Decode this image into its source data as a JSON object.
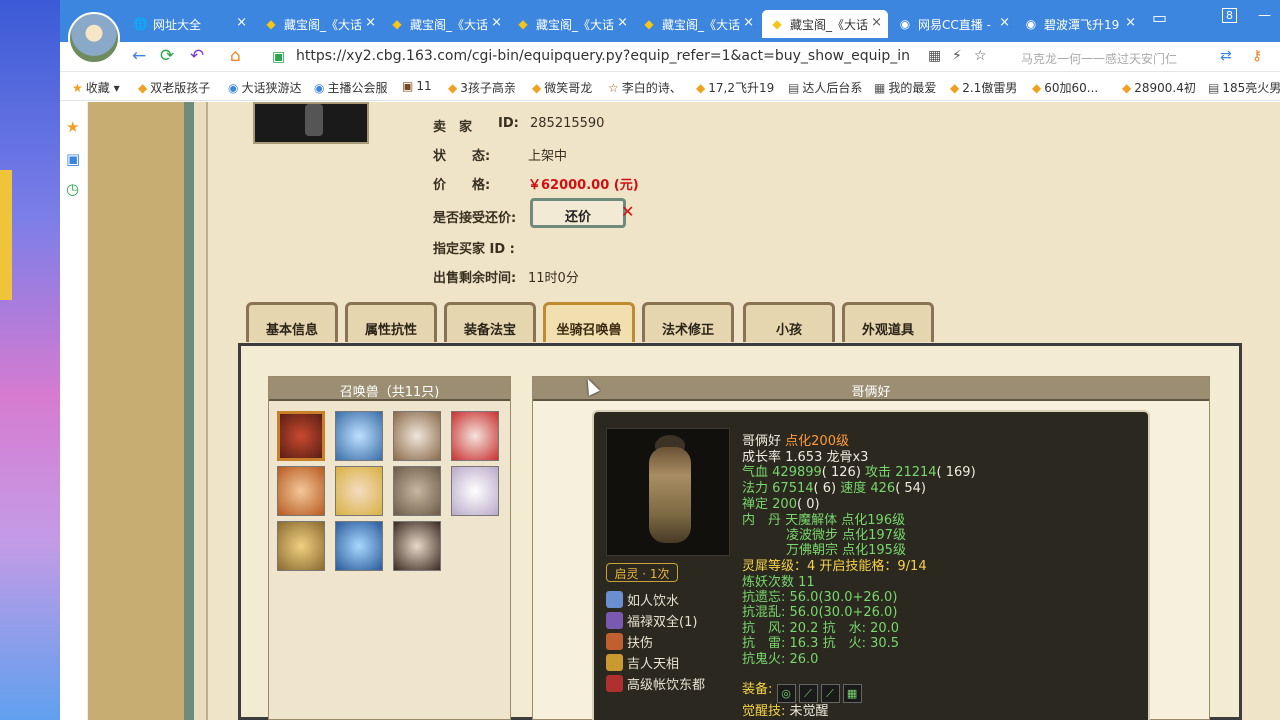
{
  "browser": {
    "tabs": [
      {
        "title": "网址大全",
        "icon": "globe-icon"
      },
      {
        "title": "藏宝阁_《大话",
        "icon": "treasure-icon"
      },
      {
        "title": "藏宝阁_《大话",
        "icon": "treasure-icon"
      },
      {
        "title": "藏宝阁_《大话",
        "icon": "treasure-icon"
      },
      {
        "title": "藏宝阁_《大话",
        "icon": "treasure-icon"
      },
      {
        "title": "藏宝阁_《大话",
        "icon": "treasure-icon"
      },
      {
        "title": "网易CC直播 -",
        "icon": "cc-icon"
      },
      {
        "title": "碧波潭飞升19",
        "icon": "cc-icon"
      }
    ],
    "tab_count_badge": "8",
    "url": "https://xy2.cbg.163.com/cgi-bin/equipquery.py?equip_refer=1&act=buy_show_equip_info&equi",
    "search_placeholder": "马克龙一何一一感过天安门仁"
  },
  "bookmarks": [
    "收藏",
    "双老版孩子",
    "大话狭游达",
    "主播公会服",
    "11",
    "3孩子高亲",
    "微笑哥龙",
    "李白的诗、",
    "17,2飞升19",
    "达人后台系",
    "我的最爱",
    "2.1傲雷男",
    "60加60...",
    "28900.4初",
    "185亮火男"
  ],
  "seller": {
    "id_label": "卖　家",
    "id_key": "ID:",
    "id": "285215590",
    "status_label": "状　　态:",
    "status": "上架中",
    "price_label": "价　　格:",
    "price": "￥62000.00 (元)",
    "counter_label": "是否接受还价:",
    "counter_button": "还价",
    "buyer_label": "指定买家 ID :",
    "remaining_label": "出售剩余时间:",
    "remaining": "11时0分"
  },
  "tabs": [
    "基本信息",
    "属性抗性",
    "装备法宝",
    "坐骑召唤兽",
    "法术修正",
    "小孩",
    "外观道具"
  ],
  "pets": {
    "header": "召唤兽（共11只)",
    "count": 11
  },
  "detail": {
    "header": "哥俩好",
    "name": "哥俩好",
    "name_suffix": "点化200级",
    "growth": "成长率 1.653 龙骨x3",
    "hp_label": "气血",
    "hp": "429899",
    "hp_extra": "( 126)",
    "atk_label": "攻击",
    "atk": "21214",
    "atk_extra": "( 169)",
    "mp_label": "法力",
    "mp": "67514",
    "mp_extra": "( 6)",
    "spd_label": "速度",
    "spd": "426",
    "spd_extra": "( 54)",
    "zen_label": "禅定",
    "zen": "200",
    "zen_extra": "( 0)",
    "neidan_label": "内　丹",
    "neidan": [
      "天魔解体 点化196级",
      "凌波微步 点化197级",
      "万佛朝宗 点化195级"
    ],
    "lingxi": "灵犀等级：4 开启技能格：9/14",
    "lianyao": "炼妖次数 11",
    "res": [
      "抗遗忘: 56.0(30.0+26.0)",
      "抗混乱: 56.0(30.0+26.0)",
      "抗　风: 20.2 抗　水: 20.0",
      "抗　雷: 16.3 抗　火: 30.5",
      "抗鬼火: 26.0"
    ],
    "equip_label": "装备:",
    "awaken_label": "觉醒技:",
    "awaken": "未觉醒",
    "qiling": "启灵 · 1次",
    "skills": [
      {
        "name": "如人饮水",
        "color": "#6a8fd0"
      },
      {
        "name": "福禄双全(1)",
        "color": "#7a5ab0"
      },
      {
        "name": "扶伤",
        "color": "#c06030"
      },
      {
        "name": "吉人天相",
        "color": "#c89a30"
      },
      {
        "name": "高级帐饮东都",
        "color": "#b03030"
      }
    ]
  },
  "colors": {
    "accent_red": "#d01010",
    "stat_green": "#7ad66e",
    "tab_active": "#c08a30"
  }
}
